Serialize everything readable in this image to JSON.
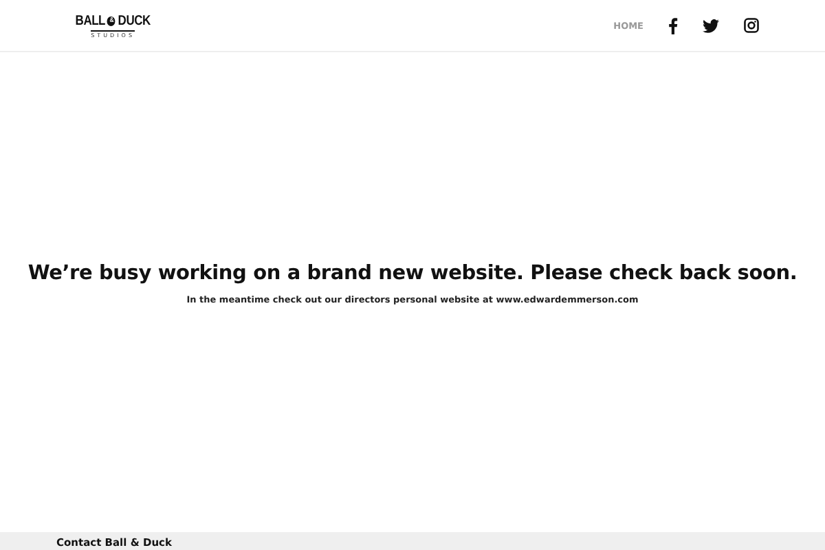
{
  "logo": {
    "name_left": "BALL",
    "mark": "&",
    "name_right": "DUCK",
    "subtitle": "STUDIOS"
  },
  "nav": {
    "items": [
      {
        "label": "HOME",
        "selected": false
      }
    ],
    "social": [
      {
        "kind": "facebook"
      },
      {
        "kind": "twitter"
      },
      {
        "kind": "instagram"
      }
    ]
  },
  "main": {
    "heading": "We’re busy working on a brand new website. Please check back soon.",
    "subheading": "In the meantime check out our directors personal website at www.edwardemmerson.com"
  },
  "footer": {
    "title": "Contact Ball & Duck"
  }
}
